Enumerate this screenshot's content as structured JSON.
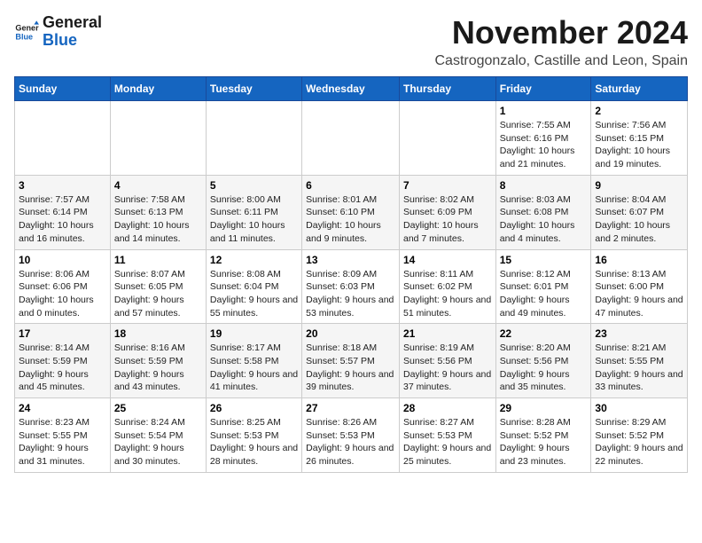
{
  "logo": {
    "general": "General",
    "blue": "Blue"
  },
  "header": {
    "month": "November 2024",
    "location": "Castrogonzalo, Castille and Leon, Spain"
  },
  "weekdays": [
    "Sunday",
    "Monday",
    "Tuesday",
    "Wednesday",
    "Thursday",
    "Friday",
    "Saturday"
  ],
  "weeks": [
    [
      {
        "day": "",
        "info": ""
      },
      {
        "day": "",
        "info": ""
      },
      {
        "day": "",
        "info": ""
      },
      {
        "day": "",
        "info": ""
      },
      {
        "day": "",
        "info": ""
      },
      {
        "day": "1",
        "info": "Sunrise: 7:55 AM\nSunset: 6:16 PM\nDaylight: 10 hours and 21 minutes."
      },
      {
        "day": "2",
        "info": "Sunrise: 7:56 AM\nSunset: 6:15 PM\nDaylight: 10 hours and 19 minutes."
      }
    ],
    [
      {
        "day": "3",
        "info": "Sunrise: 7:57 AM\nSunset: 6:14 PM\nDaylight: 10 hours and 16 minutes."
      },
      {
        "day": "4",
        "info": "Sunrise: 7:58 AM\nSunset: 6:13 PM\nDaylight: 10 hours and 14 minutes."
      },
      {
        "day": "5",
        "info": "Sunrise: 8:00 AM\nSunset: 6:11 PM\nDaylight: 10 hours and 11 minutes."
      },
      {
        "day": "6",
        "info": "Sunrise: 8:01 AM\nSunset: 6:10 PM\nDaylight: 10 hours and 9 minutes."
      },
      {
        "day": "7",
        "info": "Sunrise: 8:02 AM\nSunset: 6:09 PM\nDaylight: 10 hours and 7 minutes."
      },
      {
        "day": "8",
        "info": "Sunrise: 8:03 AM\nSunset: 6:08 PM\nDaylight: 10 hours and 4 minutes."
      },
      {
        "day": "9",
        "info": "Sunrise: 8:04 AM\nSunset: 6:07 PM\nDaylight: 10 hours and 2 minutes."
      }
    ],
    [
      {
        "day": "10",
        "info": "Sunrise: 8:06 AM\nSunset: 6:06 PM\nDaylight: 10 hours and 0 minutes."
      },
      {
        "day": "11",
        "info": "Sunrise: 8:07 AM\nSunset: 6:05 PM\nDaylight: 9 hours and 57 minutes."
      },
      {
        "day": "12",
        "info": "Sunrise: 8:08 AM\nSunset: 6:04 PM\nDaylight: 9 hours and 55 minutes."
      },
      {
        "day": "13",
        "info": "Sunrise: 8:09 AM\nSunset: 6:03 PM\nDaylight: 9 hours and 53 minutes."
      },
      {
        "day": "14",
        "info": "Sunrise: 8:11 AM\nSunset: 6:02 PM\nDaylight: 9 hours and 51 minutes."
      },
      {
        "day": "15",
        "info": "Sunrise: 8:12 AM\nSunset: 6:01 PM\nDaylight: 9 hours and 49 minutes."
      },
      {
        "day": "16",
        "info": "Sunrise: 8:13 AM\nSunset: 6:00 PM\nDaylight: 9 hours and 47 minutes."
      }
    ],
    [
      {
        "day": "17",
        "info": "Sunrise: 8:14 AM\nSunset: 5:59 PM\nDaylight: 9 hours and 45 minutes."
      },
      {
        "day": "18",
        "info": "Sunrise: 8:16 AM\nSunset: 5:59 PM\nDaylight: 9 hours and 43 minutes."
      },
      {
        "day": "19",
        "info": "Sunrise: 8:17 AM\nSunset: 5:58 PM\nDaylight: 9 hours and 41 minutes."
      },
      {
        "day": "20",
        "info": "Sunrise: 8:18 AM\nSunset: 5:57 PM\nDaylight: 9 hours and 39 minutes."
      },
      {
        "day": "21",
        "info": "Sunrise: 8:19 AM\nSunset: 5:56 PM\nDaylight: 9 hours and 37 minutes."
      },
      {
        "day": "22",
        "info": "Sunrise: 8:20 AM\nSunset: 5:56 PM\nDaylight: 9 hours and 35 minutes."
      },
      {
        "day": "23",
        "info": "Sunrise: 8:21 AM\nSunset: 5:55 PM\nDaylight: 9 hours and 33 minutes."
      }
    ],
    [
      {
        "day": "24",
        "info": "Sunrise: 8:23 AM\nSunset: 5:55 PM\nDaylight: 9 hours and 31 minutes."
      },
      {
        "day": "25",
        "info": "Sunrise: 8:24 AM\nSunset: 5:54 PM\nDaylight: 9 hours and 30 minutes."
      },
      {
        "day": "26",
        "info": "Sunrise: 8:25 AM\nSunset: 5:53 PM\nDaylight: 9 hours and 28 minutes."
      },
      {
        "day": "27",
        "info": "Sunrise: 8:26 AM\nSunset: 5:53 PM\nDaylight: 9 hours and 26 minutes."
      },
      {
        "day": "28",
        "info": "Sunrise: 8:27 AM\nSunset: 5:53 PM\nDaylight: 9 hours and 25 minutes."
      },
      {
        "day": "29",
        "info": "Sunrise: 8:28 AM\nSunset: 5:52 PM\nDaylight: 9 hours and 23 minutes."
      },
      {
        "day": "30",
        "info": "Sunrise: 8:29 AM\nSunset: 5:52 PM\nDaylight: 9 hours and 22 minutes."
      }
    ]
  ]
}
